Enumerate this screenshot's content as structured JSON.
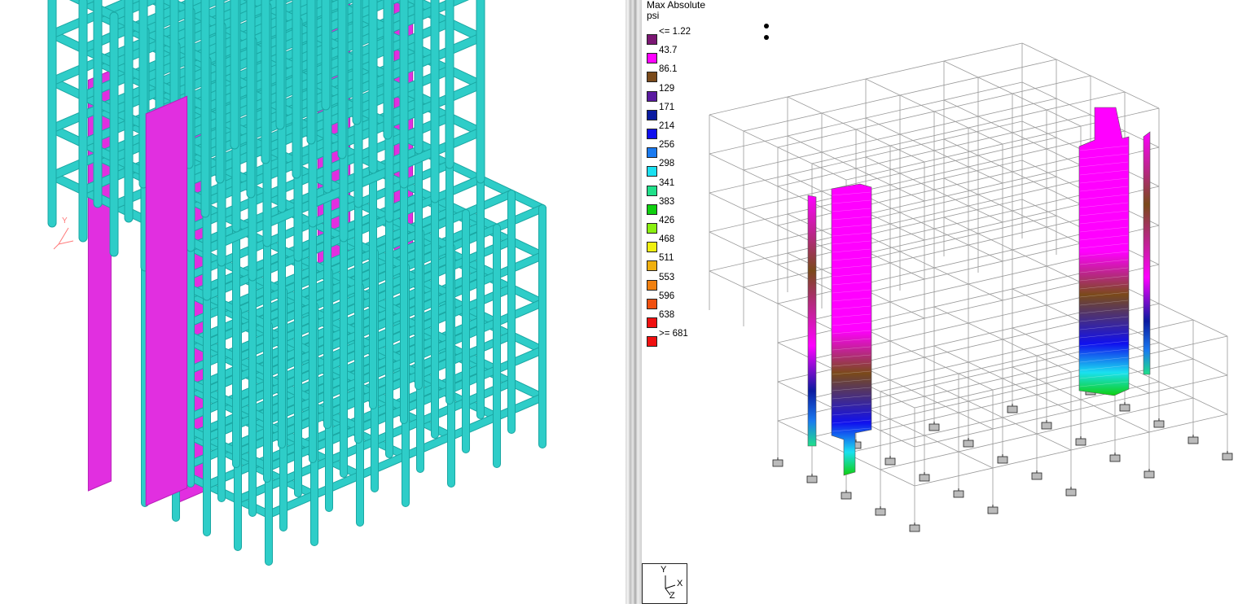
{
  "left_view": {
    "axis_marker": {
      "y_label": "Y"
    },
    "colors": {
      "frame": "#2ecdc8",
      "walls": "#e12fe0",
      "frame_edge": "#1aa7a3"
    }
  },
  "right_view": {
    "legend": {
      "title_line1": "Max Absolute",
      "title_line2": "psi",
      "entries": [
        {
          "label": "<= 1.22",
          "color": "#7b1773"
        },
        {
          "label": "43.7",
          "color": "#ff00ff"
        },
        {
          "label": "86.1",
          "color": "#7a4a1a"
        },
        {
          "label": "129",
          "color": "#5a1aa0"
        },
        {
          "label": "171",
          "color": "#0a1aa0"
        },
        {
          "label": "214",
          "color": "#1010ee"
        },
        {
          "label": "256",
          "color": "#1a7af0"
        },
        {
          "label": "298",
          "color": "#1ae0f0"
        },
        {
          "label": "341",
          "color": "#20e08a"
        },
        {
          "label": "383",
          "color": "#10d010"
        },
        {
          "label": "426",
          "color": "#8af010"
        },
        {
          "label": "468",
          "color": "#f0f010"
        },
        {
          "label": "511",
          "color": "#f0b010"
        },
        {
          "label": "553",
          "color": "#f08010"
        },
        {
          "label": "596",
          "color": "#f05010"
        },
        {
          "label": "638",
          "color": "#f01010"
        },
        {
          "label": ">= 681",
          "color": "#f01010"
        }
      ]
    },
    "axes_indicator": {
      "y": "Y",
      "x": "X",
      "z": "Z"
    },
    "colors": {
      "wireframe": "#9a9a9a",
      "support": "#555555"
    }
  }
}
